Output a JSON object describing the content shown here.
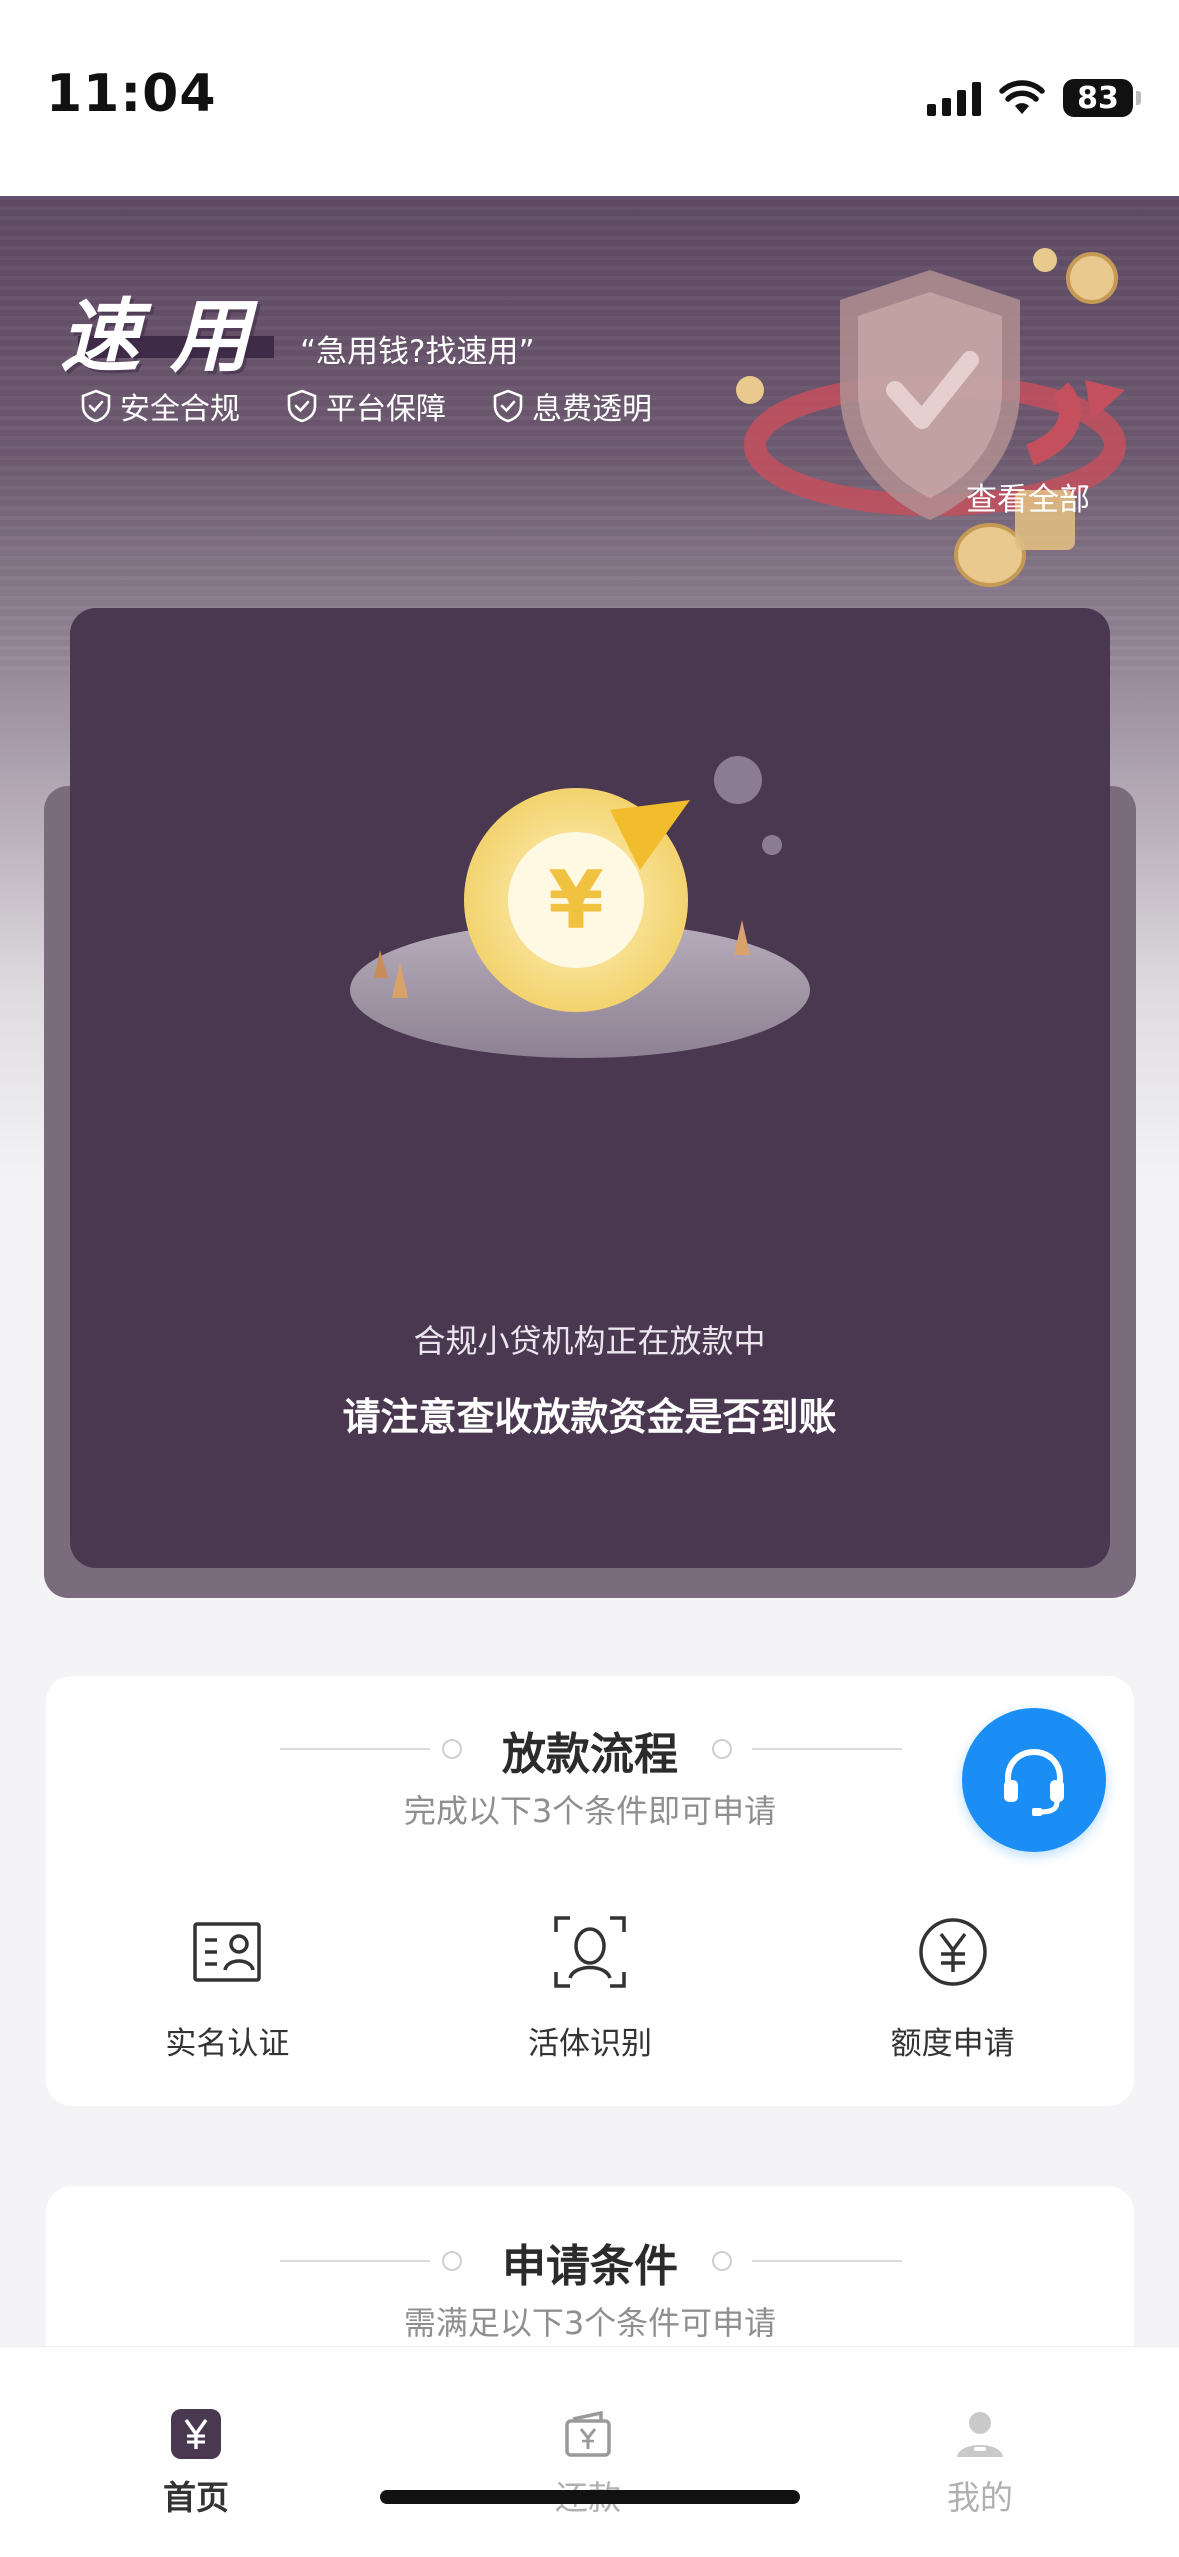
{
  "status_bar": {
    "time": "11:04",
    "battery": "83"
  },
  "brand": {
    "logo": "速用",
    "slogan": "“急用钱?找速用”",
    "badges": [
      "安全合规",
      "平台保障",
      "息费透明"
    ],
    "view_all": "查看全部"
  },
  "lending_card": {
    "status_text": "合规小贷机构正在放款中",
    "notice": "请注意查收放款资金是否到账",
    "coin_symbol": "¥"
  },
  "process": {
    "title": "放款流程",
    "subtitle": "完成以下3个条件即可申请",
    "steps": [
      {
        "label": "实名认证",
        "icon": "id-card-icon"
      },
      {
        "label": "活体识别",
        "icon": "face-scan-icon"
      },
      {
        "label": "额度申请",
        "icon": "yuan-circle-icon"
      }
    ]
  },
  "conditions": {
    "title": "申请条件",
    "subtitle": "需满足以下3个条件可申请"
  },
  "tab_bar": {
    "home": "首页",
    "repay": "还款",
    "mine": "我的"
  },
  "colors": {
    "brand_purple": "#4a3750",
    "accent_blue": "#1b8ef5",
    "coin_yellow": "#f6d977"
  }
}
